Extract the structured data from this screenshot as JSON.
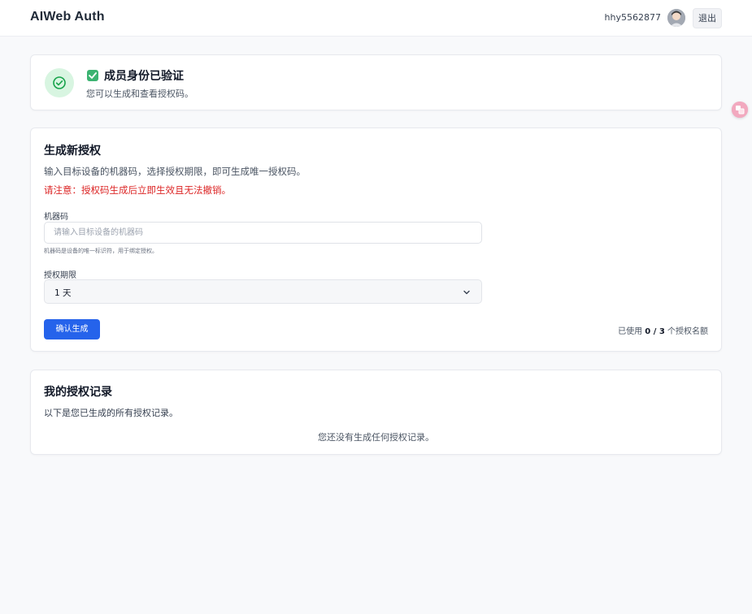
{
  "header": {
    "brand": "AIWeb Auth",
    "username": "hhy5562877",
    "logout_label": "退出"
  },
  "verified": {
    "title": "成员身份已验证",
    "subtitle": "您可以生成和查看授权码。",
    "accent": "#3cb371"
  },
  "generate": {
    "title": "生成新授权",
    "description": "输入目标设备的机器码，选择授权期限，即可生成唯一授权码。",
    "warning": "请注意：授权码生成后立即生效且无法撤销。",
    "machine_label": "机器码",
    "machine_placeholder": "请输入目标设备的机器码",
    "machine_value": "",
    "machine_hint": "机器码是设备的唯一标识符，用于绑定授权。",
    "period_label": "授权期限",
    "period_value": "1 天",
    "submit_label": "确认生成",
    "quota_prefix": "已使用",
    "quota_used": "0 / 3",
    "quota_suffix": "个授权名额",
    "primary_color": "#2563eb",
    "warning_color": "#dc2626"
  },
  "records": {
    "title": "我的授权记录",
    "description": "以下是您已生成的所有授权记录。",
    "empty_text": "您还没有生成任何授权记录。"
  },
  "floating": {
    "icon": "translate-icon"
  }
}
